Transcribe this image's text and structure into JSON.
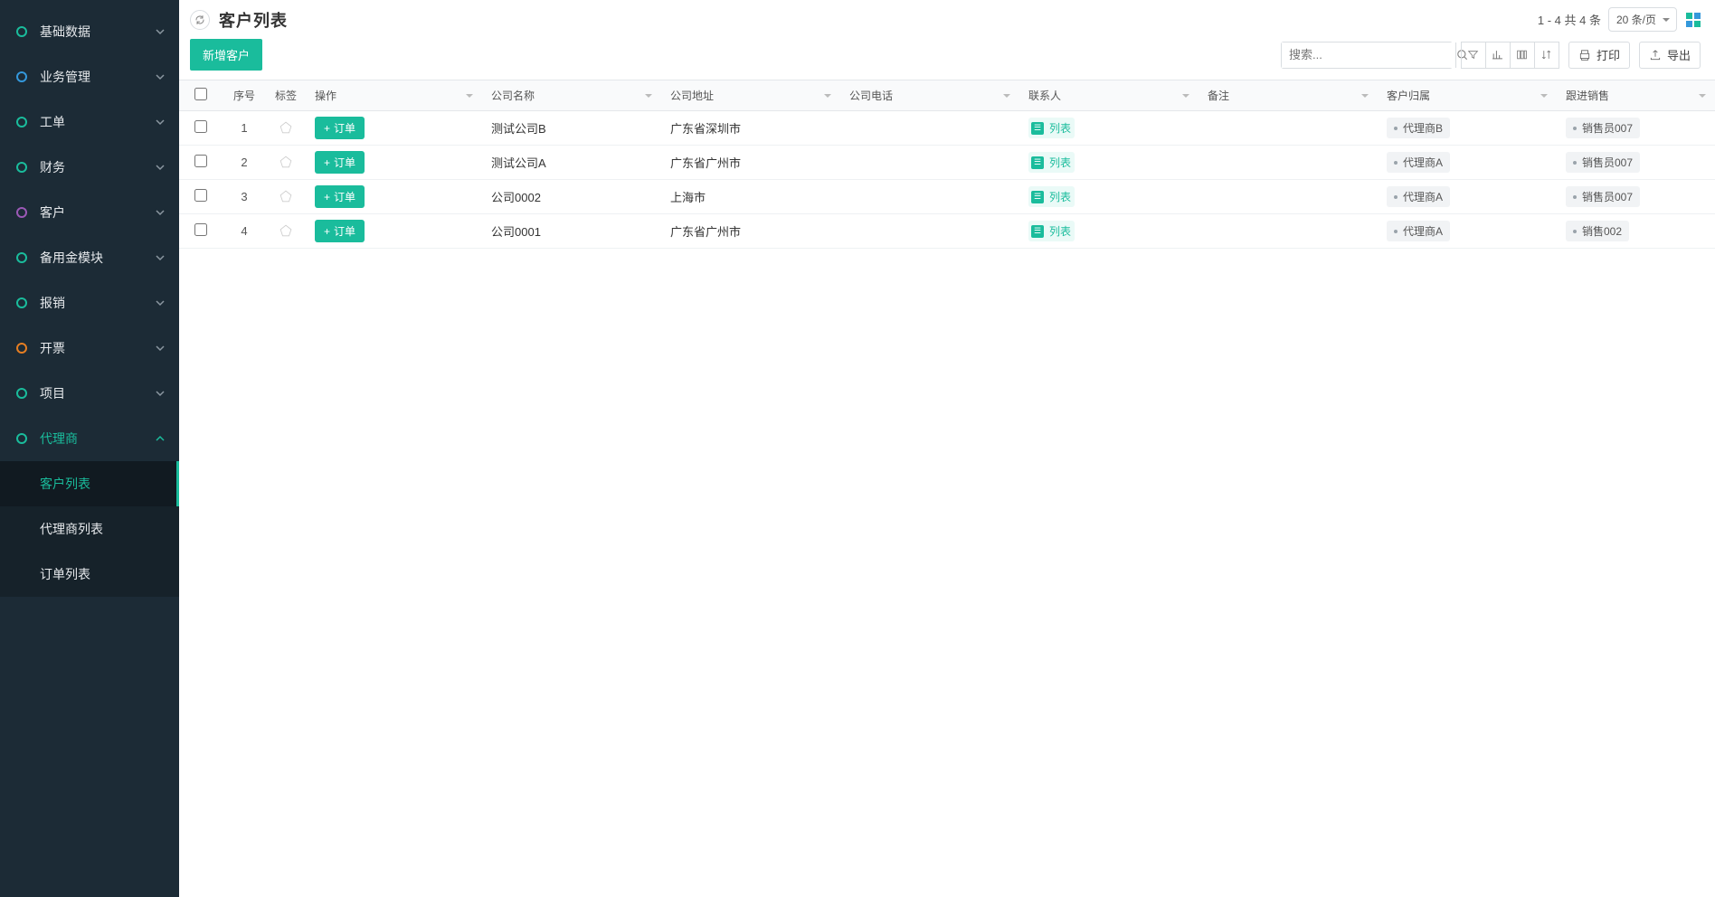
{
  "page_title": "客户列表",
  "sidebar": {
    "items": [
      {
        "label": "基础数据"
      },
      {
        "label": "业务管理"
      },
      {
        "label": "工单"
      },
      {
        "label": "财务"
      },
      {
        "label": "客户"
      },
      {
        "label": "备用金模块"
      },
      {
        "label": "报销"
      },
      {
        "label": "开票"
      },
      {
        "label": "项目"
      },
      {
        "label": "代理商",
        "expanded": true,
        "children": [
          {
            "label": "客户列表",
            "active": true
          },
          {
            "label": "代理商列表"
          },
          {
            "label": "订单列表"
          }
        ]
      }
    ]
  },
  "pagination": {
    "range_text": "1 - 4  共  4  条",
    "page_size_text": "20 条/页"
  },
  "toolbar": {
    "new_label": "新增客户",
    "search_placeholder": "搜索...",
    "print_label": "打印",
    "export_label": "导出"
  },
  "columns": {
    "index": "序号",
    "tag": "标签",
    "operation": "操作",
    "company_name": "公司名称",
    "company_addr": "公司地址",
    "company_tel": "公司电话",
    "contact": "联系人",
    "remark": "备注",
    "belong": "客户归属",
    "sales": "跟进销售"
  },
  "row_labels": {
    "order_btn": "订单",
    "list_btn": "列表"
  },
  "rows": [
    {
      "idx": "1",
      "company_name": "测试公司B",
      "company_addr": "广东省深圳市",
      "company_tel": "",
      "remark": "",
      "belong": "代理商B",
      "sales": "销售员007"
    },
    {
      "idx": "2",
      "company_name": "测试公司A",
      "company_addr": "广东省广州市",
      "company_tel": "",
      "remark": "",
      "belong": "代理商A",
      "sales": "销售员007"
    },
    {
      "idx": "3",
      "company_name": "公司0002",
      "company_addr": "上海市",
      "company_tel": "",
      "remark": "",
      "belong": "代理商A",
      "sales": "销售员007"
    },
    {
      "idx": "4",
      "company_name": "公司0001",
      "company_addr": "广东省广州市",
      "company_tel": "",
      "remark": "",
      "belong": "代理商A",
      "sales": "销售002"
    }
  ]
}
